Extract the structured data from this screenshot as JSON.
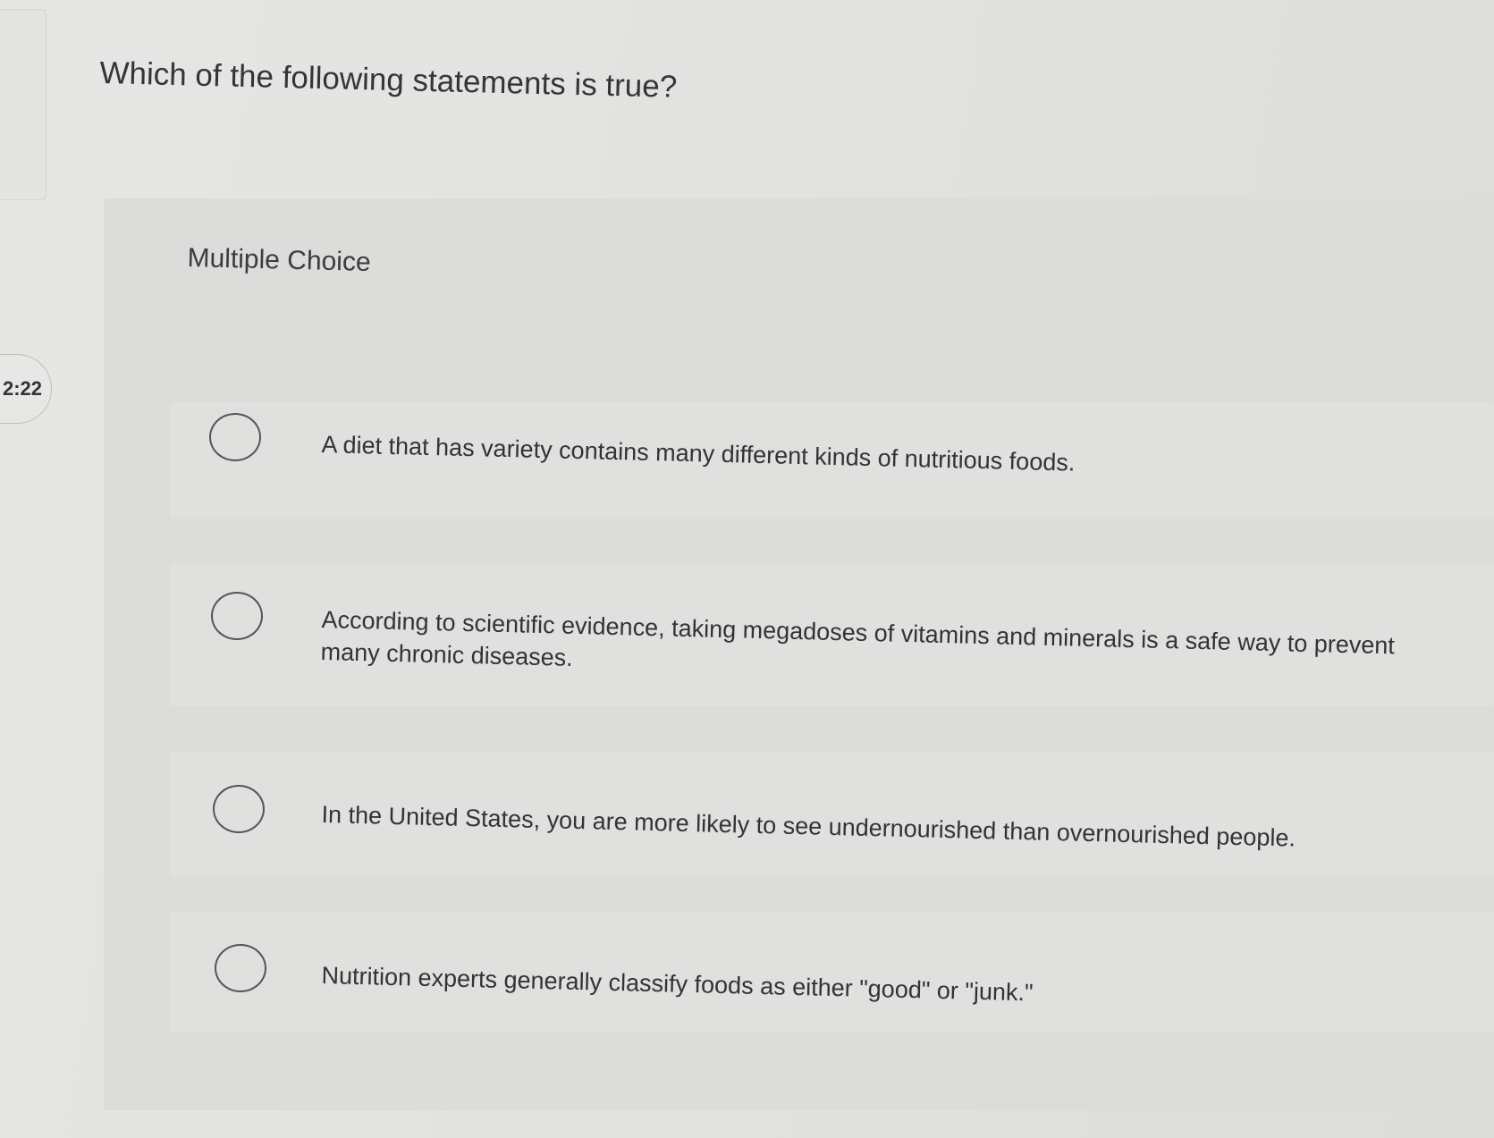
{
  "timer": {
    "text": "2:22"
  },
  "question": {
    "text": "Which of the following statements is true?"
  },
  "question_type": "Multiple Choice",
  "options": [
    {
      "text": "A diet that has variety contains many different kinds of nutritious foods."
    },
    {
      "text": "According to scientific evidence, taking megadoses of vitamins and minerals is a safe way to prevent many chronic diseases."
    },
    {
      "text": "In the United States, you are more likely to see undernourished than overnourished people."
    },
    {
      "text": "Nutrition experts generally classify foods as either \"good\" or \"junk.\""
    }
  ]
}
